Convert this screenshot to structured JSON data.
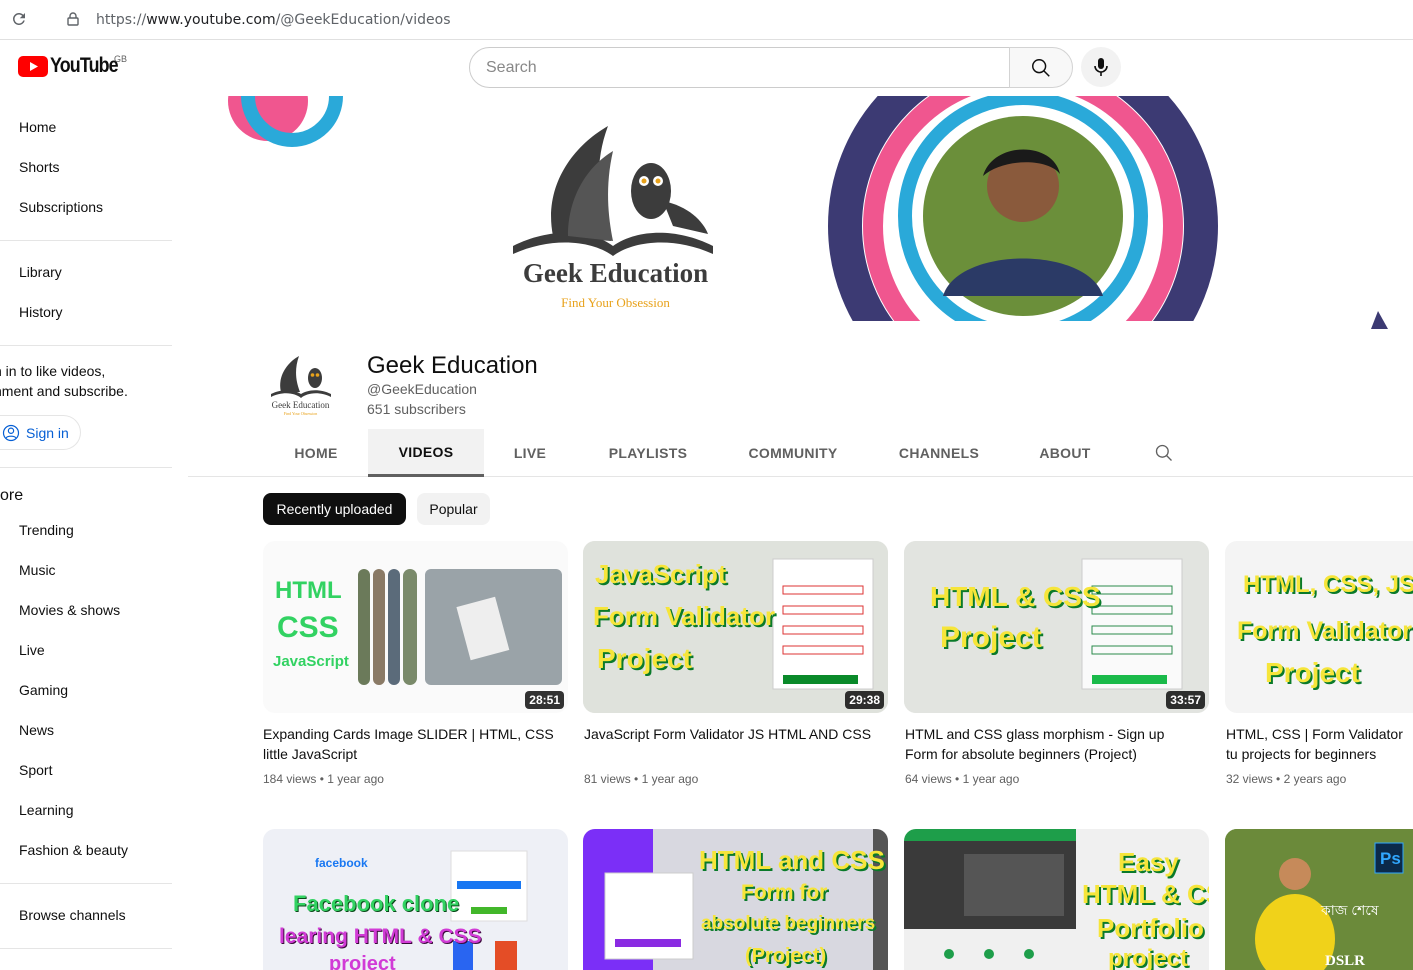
{
  "browser": {
    "url_prefix": "https://",
    "url_host": "www.youtube.com",
    "url_path": "/@GeekEducation/videos"
  },
  "masthead": {
    "logo_text": "YouTube",
    "region": "GB",
    "search_placeholder": "Search"
  },
  "sidebar": {
    "primary": [
      "Home",
      "Shorts",
      "Subscriptions"
    ],
    "secondary": [
      "Library",
      "History"
    ],
    "signin_prompt_line1": "n in to like videos,",
    "signin_prompt_line2": "nment and subscribe.",
    "signin_label": "Sign in",
    "explore_title": "ore",
    "explore": [
      "Trending",
      "Music",
      "Movies & shows",
      "Live",
      "Gaming",
      "News",
      "Sport",
      "Learning",
      "Fashion & beauty"
    ],
    "browse_channels": "Browse channels"
  },
  "banner": {
    "brand_name": "Geek Education",
    "tagline": "Find Your Obsession"
  },
  "channel": {
    "logo_name": "Geek Education",
    "logo_tagline": "Find Your Obsession",
    "name": "Geek Education",
    "handle": "@GeekEducation",
    "subscribers": "651 subscribers"
  },
  "tabs": [
    "HOME",
    "VIDEOS",
    "LIVE",
    "PLAYLISTS",
    "COMMUNITY",
    "CHANNELS",
    "ABOUT"
  ],
  "active_tab": "VIDEOS",
  "chips": [
    "Recently uploaded",
    "Popular"
  ],
  "videos": [
    {
      "title": "Expanding Cards Image SLIDER | HTML, CSS little JavaScript",
      "views": "184 views",
      "age": "1 year ago",
      "duration": "28:51",
      "thumb_text": [
        "HTML",
        "CSS",
        "JavaScript"
      ]
    },
    {
      "title": "JavaScript Form Validator JS HTML AND CSS",
      "views": "81 views",
      "age": "1 year ago",
      "duration": "29:38",
      "thumb_text": [
        "JavaScript",
        "Form Validator",
        "Project"
      ]
    },
    {
      "title": "HTML and CSS glass morphism - Sign up Form for absolute beginners (Project)",
      "views": "64 views",
      "age": "1 year ago",
      "duration": "33:57",
      "thumb_text": [
        "HTML & CSS",
        "Project"
      ]
    },
    {
      "title": "HTML, CSS | Form Validator tu projects for beginners",
      "views": "32 views",
      "age": "2 years ago",
      "duration": "",
      "thumb_text": [
        "HTML, CSS, JS",
        "Form Validator",
        "Project"
      ]
    }
  ],
  "videos_row2": [
    {
      "thumb_text": [
        "facebook",
        "Facebook clone",
        "learing HTML & CSS",
        "project"
      ]
    },
    {
      "thumb_text": [
        "HTML and CSS",
        "Form for",
        "absolute beginners",
        "(Project)"
      ]
    },
    {
      "thumb_text": [
        "Easy",
        "HTML & CSS",
        "Portfolio",
        "project"
      ]
    },
    {
      "thumb_text": [
        "Ps",
        "কাজ শেষে",
        "DSLR"
      ]
    }
  ],
  "colors": {
    "youtube_red": "#ff0000",
    "link_blue": "#065fd4",
    "banner_pink": "#f0568f",
    "banner_navy": "#3c3a73",
    "banner_cyan": "#2aa9d9",
    "thumb_green": "#32d262",
    "thumb_yellow": "#f6e53a"
  }
}
